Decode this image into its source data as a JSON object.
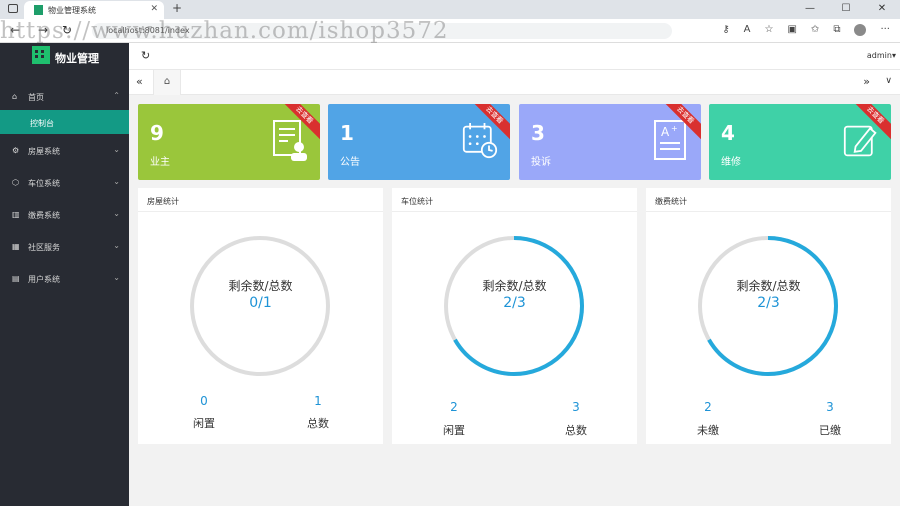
{
  "browser": {
    "tab_title": "物业管理系统",
    "url": "localhost:8081/index",
    "watermark": "https://www.huzhan.com/ishop3572"
  },
  "app": {
    "logo_text": "物业管理",
    "user": "admin▾"
  },
  "sidebar": {
    "items": [
      {
        "label": "首页",
        "icon": "home-icon",
        "chevron": "⌃"
      },
      {
        "label": "房屋系统",
        "icon": "gear-icon",
        "chevron": "⌄"
      },
      {
        "label": "车位系统",
        "icon": "cube-icon",
        "chevron": "⌄"
      },
      {
        "label": "缴费系统",
        "icon": "grid-icon",
        "chevron": "⌄"
      },
      {
        "label": "社区服务",
        "icon": "building-icon",
        "chevron": "⌄"
      },
      {
        "label": "用户系统",
        "icon": "book-icon",
        "chevron": "⌄"
      }
    ],
    "active_sub": "控制台"
  },
  "cards": [
    {
      "value": "9",
      "label": "业主",
      "ribbon": "去查看",
      "color": "#9ac63b"
    },
    {
      "value": "1",
      "label": "公告",
      "ribbon": "去查看",
      "color": "#51a4e6"
    },
    {
      "value": "3",
      "label": "投诉",
      "ribbon": "去查看",
      "color": "#9aa8f9"
    },
    {
      "value": "4",
      "label": "维修",
      "ribbon": "去查看",
      "color": "#3fd1a7"
    }
  ],
  "panels": [
    {
      "title": "房屋统计",
      "ring_label": "剩余数/总数",
      "ring_value": "0/1",
      "fraction": 0,
      "left_value": "0",
      "left_label": "闲置",
      "right_value": "1",
      "right_label": "总数"
    },
    {
      "title": "车位统计",
      "ring_label": "剩余数/总数",
      "ring_value": "2/3",
      "fraction": 0.667,
      "left_value": "2",
      "left_label": "闲置",
      "right_value": "3",
      "right_label": "总数"
    },
    {
      "title": "缴费统计",
      "ring_label": "剩余数/总数",
      "ring_value": "2/3",
      "fraction": 0.667,
      "left_value": "2",
      "left_label": "未缴",
      "right_value": "3",
      "right_label": "已缴"
    }
  ],
  "colors": {
    "ring_fill": "#25a9dc",
    "ring_track": "#dddddd",
    "sidebar_bg": "#282b33",
    "sidebar_active": "#139a85"
  }
}
